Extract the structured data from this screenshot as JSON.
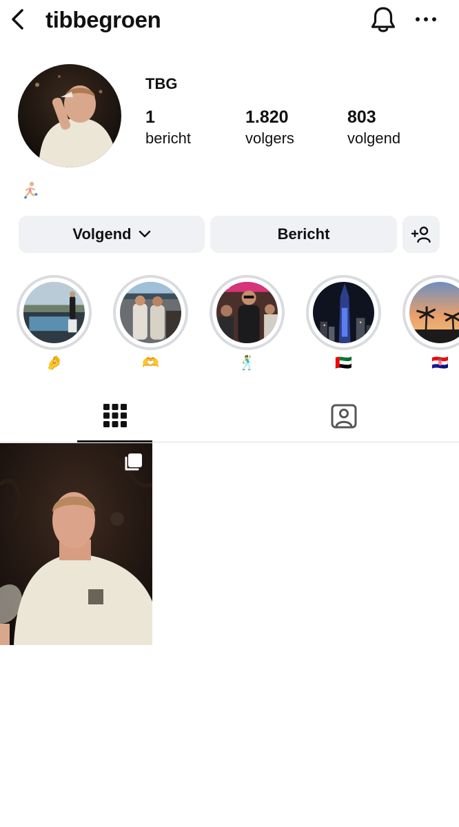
{
  "header": {
    "username": "tibbegroen",
    "back_icon": "chevron-left-icon",
    "notifications_icon": "bell-icon",
    "more_icon": "ellipsis-icon"
  },
  "profile": {
    "display_name": "TBG",
    "bio": "🏃",
    "stats": [
      {
        "value": "1",
        "label": "bericht"
      },
      {
        "value": "1.820",
        "label": "volgers"
      },
      {
        "value": "803",
        "label": "volgend"
      }
    ]
  },
  "actions": {
    "follow_label": "Volgend",
    "message_label": "Bericht",
    "add_user_icon": "add-person-icon"
  },
  "highlights": [
    {
      "label": "🤌"
    },
    {
      "label": "🫶"
    },
    {
      "label": "🕺"
    },
    {
      "label": "🇦🇪"
    },
    {
      "label": "🇭🇷"
    }
  ],
  "tabs": [
    {
      "name": "posts",
      "icon": "grid-icon",
      "active": true
    },
    {
      "name": "tagged",
      "icon": "tagged-person-icon",
      "active": false
    }
  ],
  "posts": [
    {
      "type": "carousel",
      "icon": "multiple-photos-icon"
    }
  ],
  "colors": {
    "button_bg": "#eff1f4",
    "highlight_ring": "#d9dbe0",
    "divider": "#dbdbdb",
    "text": "#111111"
  }
}
